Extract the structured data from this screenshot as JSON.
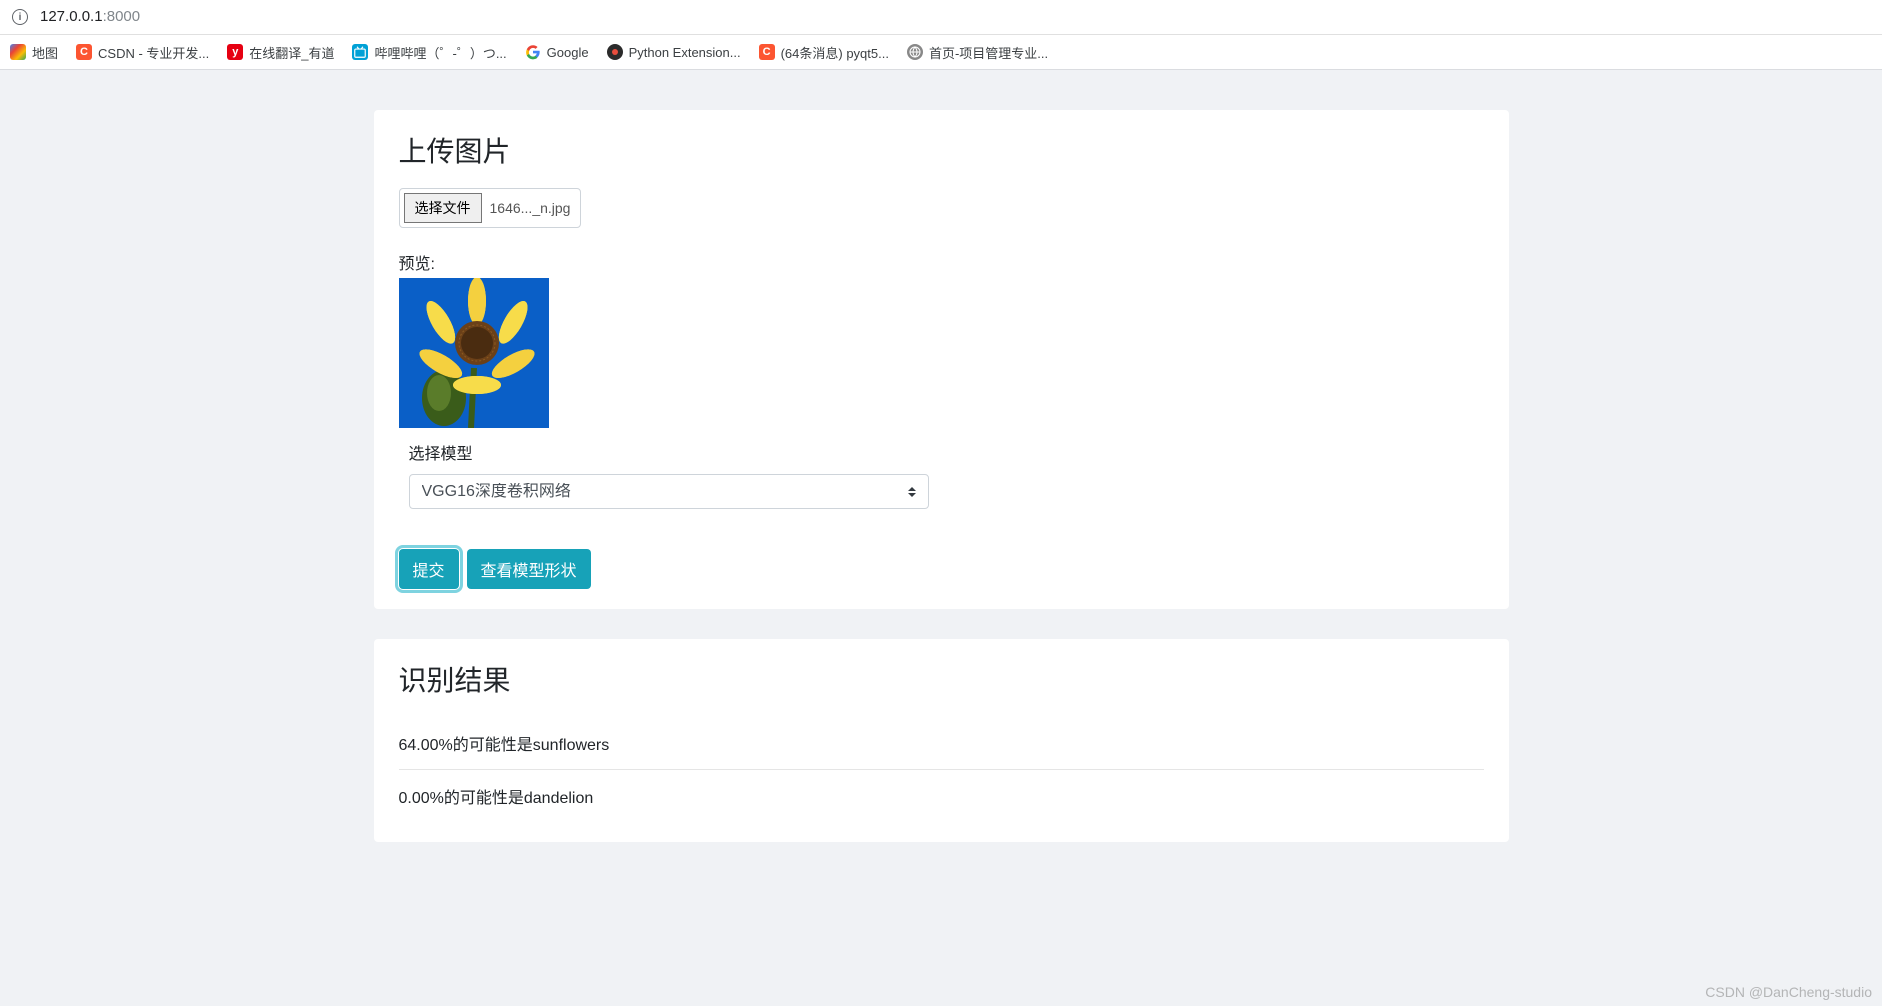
{
  "address": {
    "host": "127.0.0.1",
    "port": ":8000"
  },
  "bookmarks": [
    {
      "label": "地图",
      "icon": "maps"
    },
    {
      "label": "CSDN - 专业开发...",
      "icon": "csdn"
    },
    {
      "label": "在线翻译_有道",
      "icon": "youdao"
    },
    {
      "label": "哔哩哔哩（゜-゜）つ...",
      "icon": "bili"
    },
    {
      "label": "Google",
      "icon": "google"
    },
    {
      "label": "Python Extension...",
      "icon": "python"
    },
    {
      "label": "(64条消息) pyqt5...",
      "icon": "csdn"
    },
    {
      "label": "首页-项目管理专业...",
      "icon": "globe"
    }
  ],
  "upload": {
    "title": "上传图片",
    "choose_file_label": "选择文件",
    "filename": "1646..._n.jpg",
    "preview_label": "预览:",
    "model_label": "选择模型",
    "model_selected": "VGG16深度卷积网络",
    "submit_label": "提交",
    "view_shape_label": "查看模型形状"
  },
  "results": {
    "title": "识别结果",
    "items": [
      "64.00%的可能性是sunflowers",
      "0.00%的可能性是dandelion"
    ]
  },
  "watermark": "CSDN @DanCheng-studio"
}
